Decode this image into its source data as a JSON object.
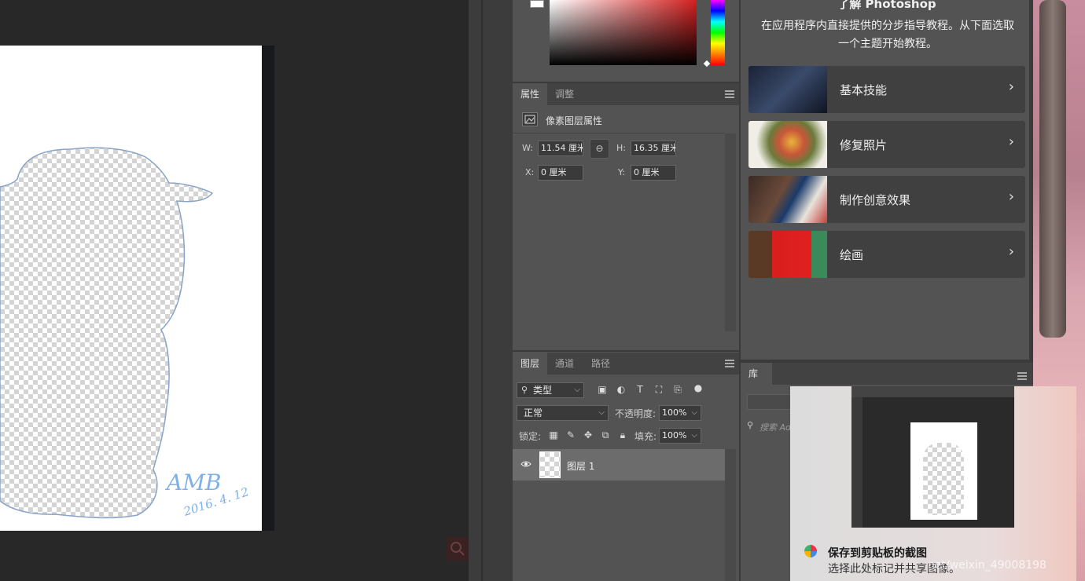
{
  "canvas": {
    "signature": "AMB",
    "signature_date": "2016. 4. 12"
  },
  "properties_panel": {
    "tabs": [
      "属性",
      "调整"
    ],
    "layer_type": "像素图层属性",
    "w_label": "W:",
    "w_value": "11.54 厘米",
    "h_label": "H:",
    "h_value": "16.35 厘米",
    "x_label": "X:",
    "x_value": "0 厘米",
    "y_label": "Y:",
    "y_value": "0 厘米"
  },
  "layers_panel": {
    "tabs": [
      "图层",
      "通道",
      "路径"
    ],
    "filter_kind": "类型",
    "blend_mode": "正常",
    "opacity_label": "不透明度:",
    "opacity_value": "100%",
    "lock_label": "锁定:",
    "fill_label": "填充:",
    "fill_value": "100%",
    "layer_name": "图层 1"
  },
  "learn_panel": {
    "title": "了解 Photoshop",
    "description": "在应用程序内直接提供的分步指导教程。从下面选取一个主题开始教程。",
    "cards": [
      {
        "label": "基本技能"
      },
      {
        "label": "修复照片"
      },
      {
        "label": "制作创意效果"
      },
      {
        "label": "绘画"
      }
    ]
  },
  "library_panel": {
    "tab": "库",
    "search_placeholder": "搜索 Ad"
  },
  "notification": {
    "title": "保存到剪贴板的截图",
    "subtitle": "选择此处标记并共享图像。"
  },
  "watermark": "net/weixin_49008198",
  "colors": {
    "panel_bg": "#535353",
    "canvas_bg": "#282828",
    "accent_red": "#d42020"
  }
}
